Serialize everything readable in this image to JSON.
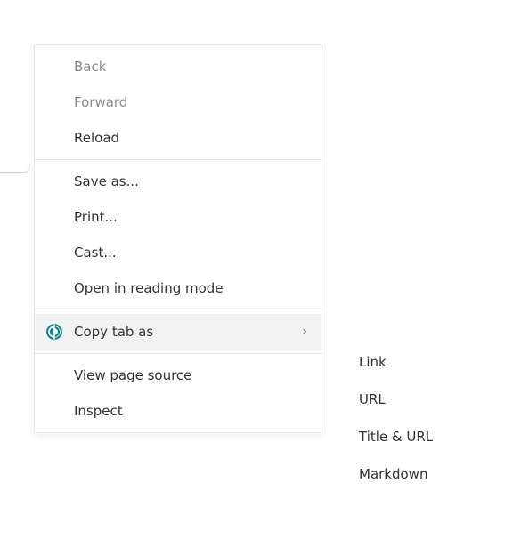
{
  "context_menu": {
    "items": {
      "back": {
        "label": "Back"
      },
      "forward": {
        "label": "Forward"
      },
      "reload": {
        "label": "Reload"
      },
      "save_as": {
        "label": "Save as..."
      },
      "print": {
        "label": "Print..."
      },
      "cast": {
        "label": "Cast..."
      },
      "reading_mode": {
        "label": "Open in reading mode"
      },
      "copy_tab_as": {
        "label": "Copy tab as",
        "has_submenu": true
      },
      "view_source": {
        "label": "View page source"
      },
      "inspect": {
        "label": "Inspect"
      }
    }
  },
  "submenu": {
    "items": {
      "link": {
        "label": "Link"
      },
      "url": {
        "label": "URL"
      },
      "title_url": {
        "label": "Title & URL"
      },
      "markdown": {
        "label": "Markdown"
      }
    }
  },
  "icons": {
    "extension": "circle-split-icon",
    "chevron": "›"
  },
  "colors": {
    "divider": "#e6e6e6",
    "hover_bg": "#f2f2f2",
    "disabled_text": "#8a8a8a",
    "icon_teal": "#0f7d85"
  }
}
